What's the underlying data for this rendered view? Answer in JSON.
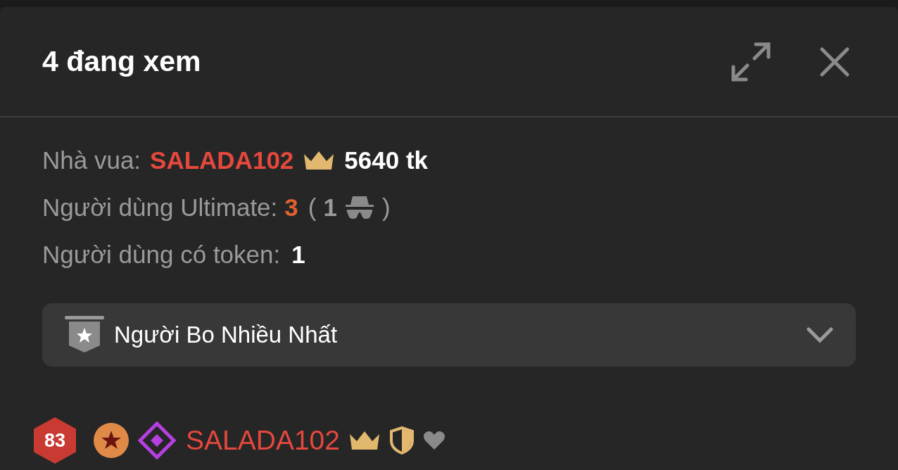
{
  "header": {
    "title": "4 đang xem"
  },
  "stats": {
    "king_label": "Nhà vua:",
    "king_name": "SALADA102",
    "king_tokens": "5640 tk",
    "ultimate_label": "Người dùng Ultimate:",
    "ultimate_count": "3",
    "paren_open": "(",
    "anonymous_count": "1",
    "paren_close": ")",
    "token_label": "Người dùng có token:",
    "token_count": "1"
  },
  "dropdown": {
    "label": "Người Bo Nhiều Nhất",
    "expanded": false
  },
  "users": [
    {
      "level": "83",
      "name": "SALADA102"
    }
  ]
}
